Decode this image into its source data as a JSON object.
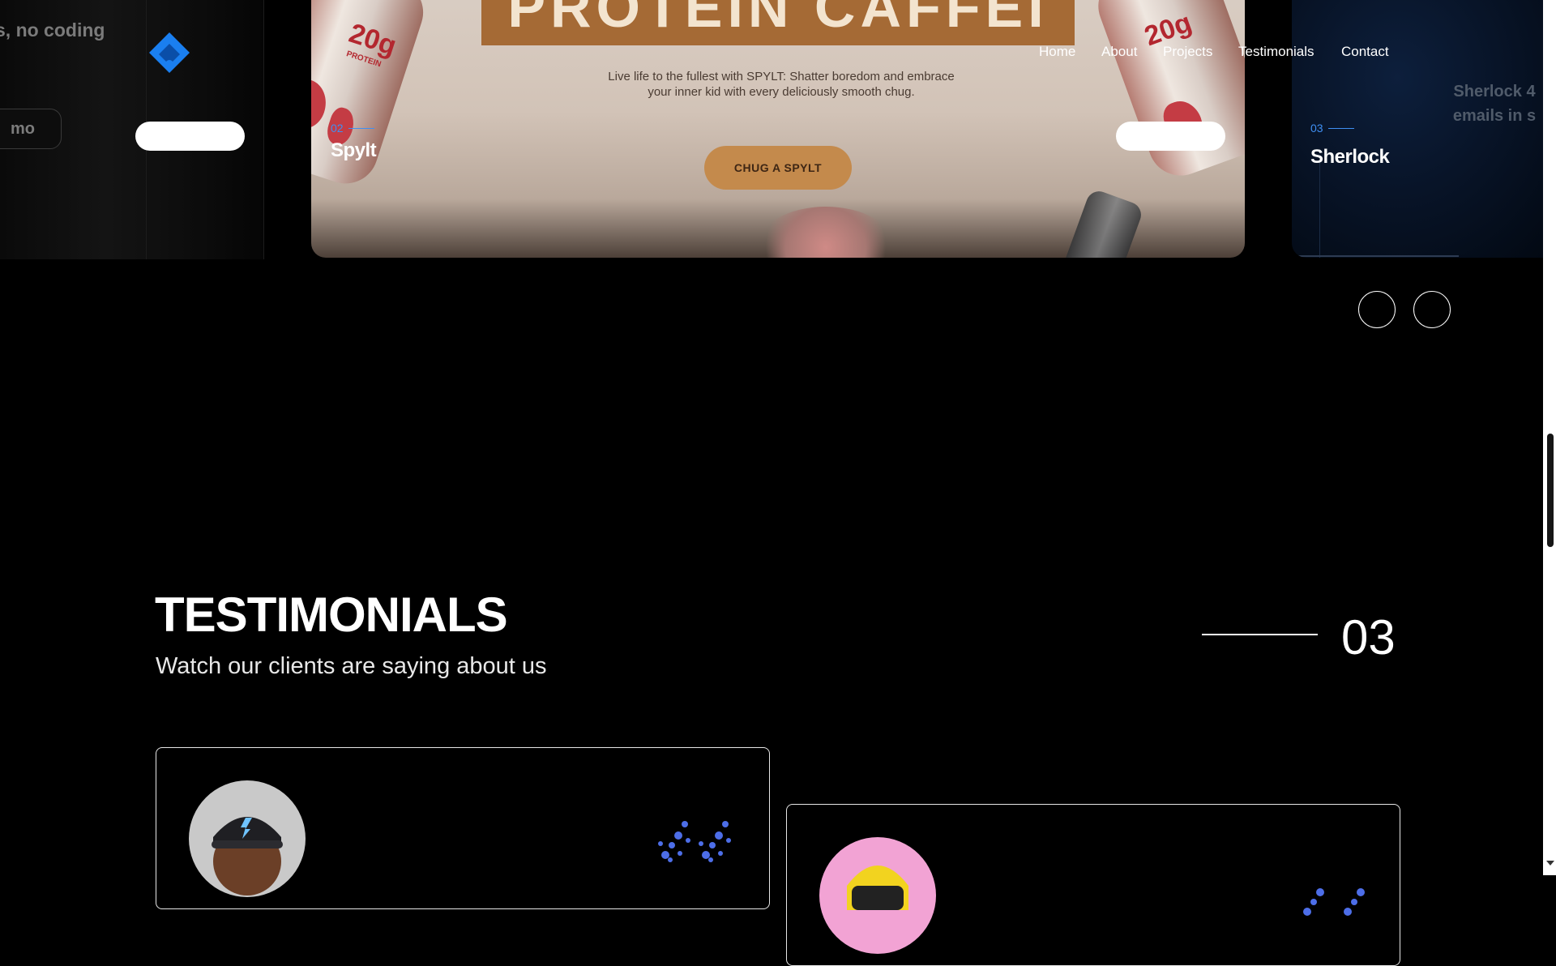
{
  "header": {
    "logo_icon": "diamond-logo-icon",
    "brand_color": "#1a7ff0",
    "nav": [
      "Home",
      "About",
      "Projects",
      "Testimonials",
      "Contact"
    ]
  },
  "projects": {
    "left_slide": {
      "tagline": "s, no coding",
      "demo_label": "mo"
    },
    "main_slide": {
      "number": "02",
      "title": "Spylt",
      "banner_text": "PROTEIN  CAFFEI",
      "can_label_left": "20g",
      "can_sub_left": "PROTEIN",
      "can_label_right": "20g",
      "copy": "Live life to the fullest  with SPYLT: Shatter boredom and embrace your inner kid with every deliciously smooth chug.",
      "cta_label": "CHUG A SPYLT"
    },
    "right_slide": {
      "number": "03",
      "title": "Sherlock",
      "ghost_line1": "Sherlock 4",
      "ghost_line2": "emails in s"
    },
    "accent_color": "#3f8ff2",
    "controls": {
      "prev_icon": "circle-prev-icon",
      "next_icon": "circle-next-icon"
    }
  },
  "testimonials": {
    "title": "TESTIMONIALS",
    "subtitle": "Watch our clients are saying about us",
    "section_number": "03",
    "quote_icon": "quote-dots-icon",
    "quote_color": "#4d6ee8",
    "cards": [
      {
        "avatar_icon": "avatar-man-cap-icon"
      },
      {
        "avatar_icon": "avatar-yellow-helmet-icon"
      }
    ]
  }
}
